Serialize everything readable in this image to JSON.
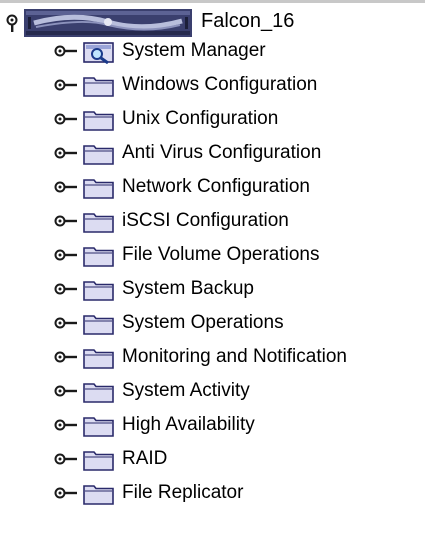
{
  "tree": {
    "root": {
      "label": "Falcon_16",
      "icon": "server-icon",
      "expanded": true
    },
    "items": [
      {
        "label": "System Manager",
        "icon": "system-manager-icon"
      },
      {
        "label": "Windows Configuration",
        "icon": "folder-icon"
      },
      {
        "label": "Unix Configuration",
        "icon": "folder-icon"
      },
      {
        "label": "Anti Virus Configuration",
        "icon": "folder-icon"
      },
      {
        "label": "Network Configuration",
        "icon": "folder-icon"
      },
      {
        "label": "iSCSI Configuration",
        "icon": "folder-icon"
      },
      {
        "label": "File Volume Operations",
        "icon": "folder-icon"
      },
      {
        "label": "System Backup",
        "icon": "folder-icon"
      },
      {
        "label": "System Operations",
        "icon": "folder-icon"
      },
      {
        "label": "Monitoring and Notification",
        "icon": "folder-icon"
      },
      {
        "label": "System Activity",
        "icon": "folder-icon"
      },
      {
        "label": "High Availability",
        "icon": "folder-icon"
      },
      {
        "label": "RAID",
        "icon": "folder-icon"
      },
      {
        "label": "File Replicator",
        "icon": "folder-icon"
      }
    ]
  },
  "colors": {
    "folder_fill": "#dcdcf2",
    "folder_stroke": "#2a2a6a",
    "handle": "#1a1a1a",
    "server_body": "#3a3f6e",
    "server_highlight": "#b8bedc"
  }
}
